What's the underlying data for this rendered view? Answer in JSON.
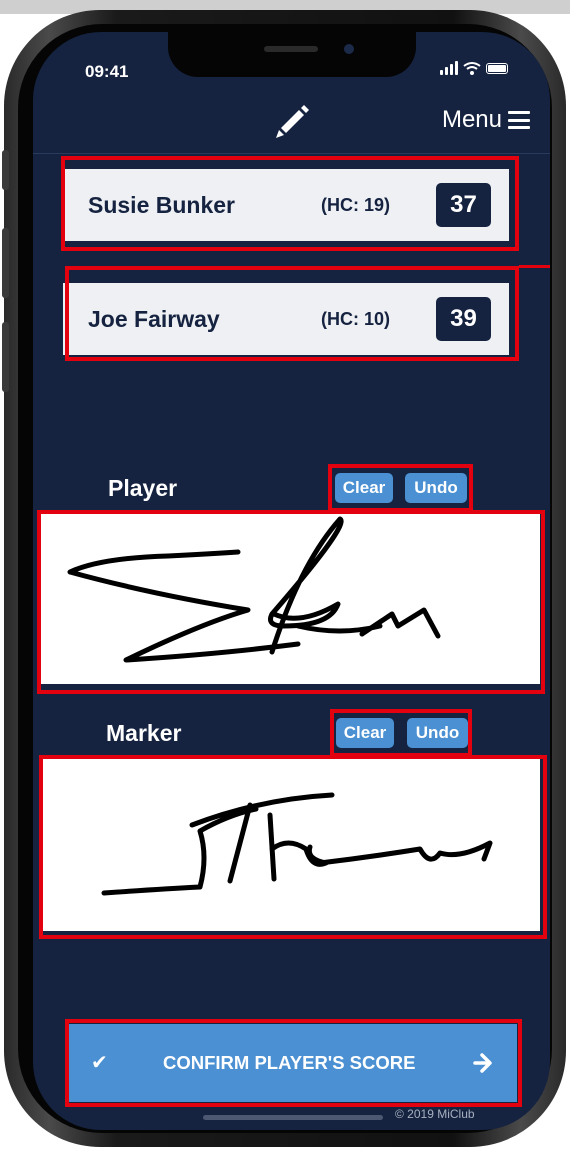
{
  "status_bar": {
    "time": "09:41"
  },
  "header": {
    "menu_label": "Menu"
  },
  "players": [
    {
      "name": "Susie Bunker",
      "handicap": "(HC: 19)",
      "score": "37"
    },
    {
      "name": "Joe Fairway",
      "handicap": "(HC: 10)",
      "score": "39"
    }
  ],
  "signatures": {
    "player": {
      "label": "Player",
      "clear_label": "Clear",
      "undo_label": "Undo"
    },
    "marker": {
      "label": "Marker",
      "clear_label": "Clear",
      "undo_label": "Undo"
    }
  },
  "confirm": {
    "check_icon": "✔",
    "label": "CONFIRM PLAYER'S SCORE"
  },
  "footer": {
    "copyright": "© 2019 MiClub"
  },
  "colors": {
    "background": "#152340",
    "accent": "#4a90d2",
    "highlight": "#e3000f",
    "card": "#eef0f3"
  }
}
